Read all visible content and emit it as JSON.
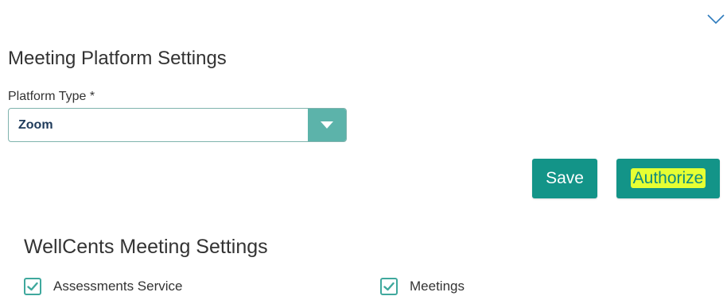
{
  "header": {
    "collapse_icon": "chevron-down-icon"
  },
  "platform_settings": {
    "title": "Meeting Platform Settings",
    "platform_type": {
      "label": "Platform Type *",
      "selected_value": "Zoom",
      "dropdown_icon": "caret-down-icon"
    }
  },
  "actions": {
    "save_label": "Save",
    "authorize_label": "Authorize",
    "authorize_highlight_color": "#e6ff33",
    "button_color": "#139488"
  },
  "wellcents_settings": {
    "title": "WellCents Meeting Settings",
    "options": [
      {
        "label": "Assessments Service",
        "checked": true
      },
      {
        "label": "Meetings",
        "checked": true
      }
    ]
  }
}
